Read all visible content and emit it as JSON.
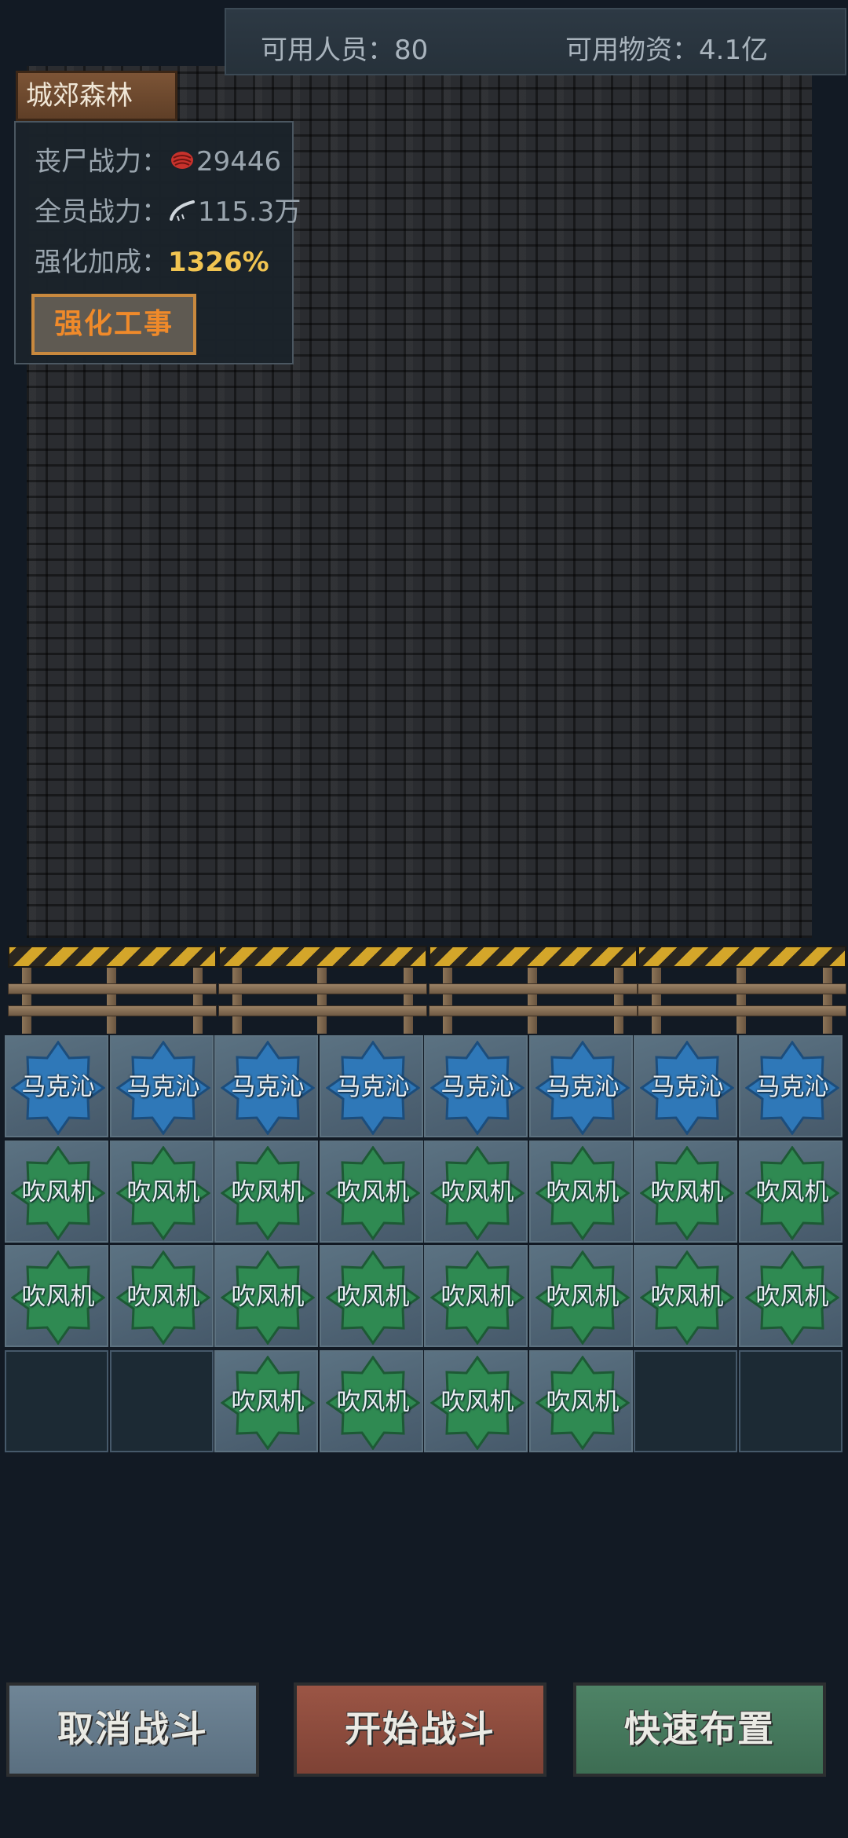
{
  "topbar": {
    "personnel_label": "可用人员：80",
    "supplies_label": "可用物资：4.1亿"
  },
  "location": {
    "name": "城郊森林"
  },
  "info_panel": {
    "zombie_power_label": "丧尸战力：",
    "zombie_power_value": "29446",
    "team_power_label": "全员战力：",
    "team_power_value": "115.3万",
    "boost_label": "强化加成：",
    "boost_value": "1326%",
    "fortify_button": "强化工事"
  },
  "units": {
    "row1": [
      "马克沁",
      "马克沁",
      "马克沁",
      "马克沁",
      "马克沁",
      "马克沁",
      "马克沁",
      "马克沁"
    ],
    "row2": [
      "吹风机",
      "吹风机",
      "吹风机",
      "吹风机",
      "吹风机",
      "吹风机",
      "吹风机",
      "吹风机"
    ],
    "row3": [
      "吹风机",
      "吹风机",
      "吹风机",
      "吹风机",
      "吹风机",
      "吹风机",
      "吹风机",
      "吹风机"
    ],
    "row4": [
      "",
      "",
      "吹风机",
      "吹风机",
      "吹风机",
      "吹风机",
      "",
      ""
    ]
  },
  "colors": {
    "maxim_unit": "#2f78b8",
    "fan_unit": "#2f8a52",
    "boost_value": "#f1c451",
    "fortify_text": "#f08a2a"
  },
  "buttons": {
    "cancel": "取消战斗",
    "start": "开始战斗",
    "quick": "快速布置"
  }
}
